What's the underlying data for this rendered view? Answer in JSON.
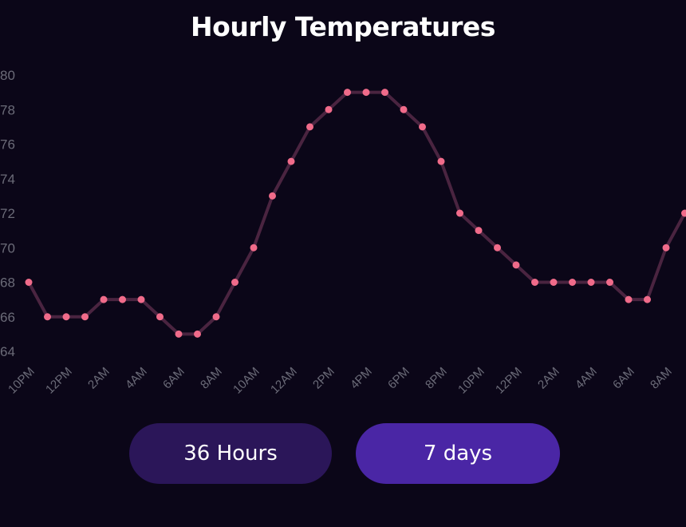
{
  "title": "Hourly Temperatures",
  "buttons": {
    "hours36": "36 Hours",
    "days7": "7 days"
  },
  "colors": {
    "background": "#0b0618",
    "line": "#4a2440",
    "point": "#f06b8a",
    "button_inactive": "#2b1659",
    "button_active": "#4a26a5"
  },
  "chart_data": {
    "type": "line",
    "title": "Hourly Temperatures",
    "xlabel": "",
    "ylabel": "",
    "ylim": [
      64,
      80
    ],
    "yticks": [
      "64",
      "66",
      "68",
      "70",
      "72",
      "74",
      "76",
      "78",
      "80"
    ],
    "xticks": [
      "10PM",
      "12PM",
      "2AM",
      "4AM",
      "6AM",
      "8AM",
      "10AM",
      "12AM",
      "2PM",
      "4PM",
      "6PM",
      "8PM",
      "10PM",
      "12PM",
      "2AM",
      "4AM",
      "6AM",
      "8AM"
    ],
    "grid": false,
    "series": [
      {
        "values": [
          68,
          66,
          66,
          66,
          67,
          67,
          67,
          66,
          65,
          65,
          66,
          68,
          70,
          73,
          75,
          77,
          78,
          79,
          79,
          79,
          78,
          77,
          75,
          72,
          71,
          70,
          69,
          68,
          68,
          68,
          68,
          68,
          67,
          67,
          70,
          72
        ]
      }
    ]
  }
}
